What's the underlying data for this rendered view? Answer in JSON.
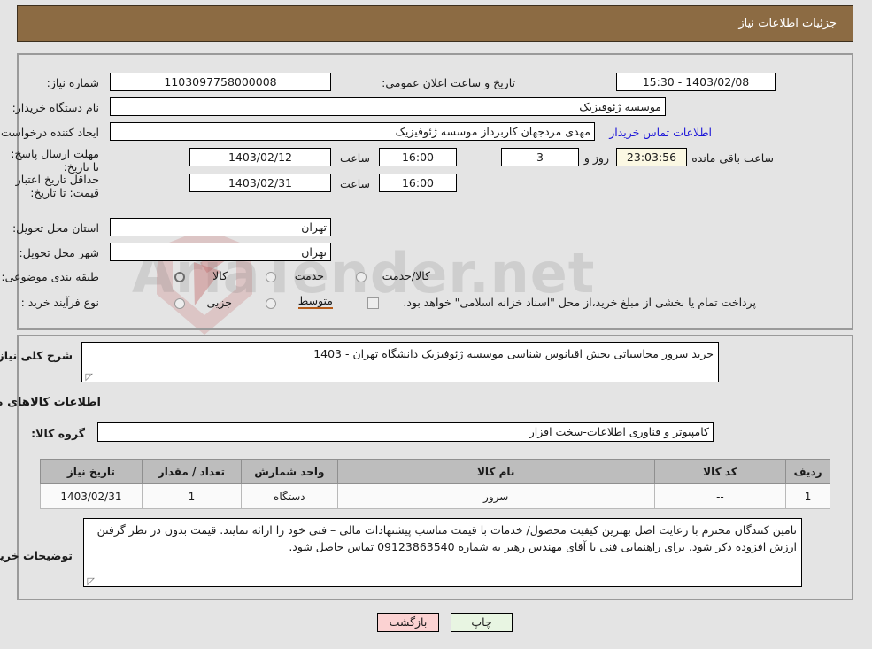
{
  "header": {
    "title": "جزئیات اطلاعات نیاز"
  },
  "watermark": {
    "text": "AriaTender.net",
    "shield_icon": "shield-icon"
  },
  "top_panel": {
    "fields": [
      {
        "label": "شماره نیاز:",
        "value": "1103097758000008"
      },
      {
        "label": "نام دستگاه خریدار:",
        "value": "موسسه ژئوفیزیک"
      },
      {
        "label": "ایجاد کننده درخواست:",
        "value": "مهدی مردجهان کاربرداز موسسه ژئوفیزیک"
      },
      {
        "label": "مهلت ارسال پاسخ: تا تاریخ:",
        "value": "1403/02/12"
      },
      {
        "label": "حداقل تاریخ اعتبار قیمت: تا تاریخ:",
        "value": "1403/02/31"
      },
      {
        "label": "استان محل تحویل:",
        "value": "تهران"
      },
      {
        "label": "شهر محل تحویل:",
        "value": "تهران"
      },
      {
        "label": "طبقه بندی موضوعی:",
        "value": "کالا"
      },
      {
        "label": "نوع فرآیند خرید :",
        "value": "متوسط"
      }
    ],
    "public_announce_label": "تاریخ و ساعت اعلان عمومی:",
    "public_announce_value": "1403/02/08 - 15:30",
    "contact_link": "اطلاعات تماس خریدار",
    "deadline_time_label": "ساعت",
    "deadline_time_value": "16:00",
    "days_value": "3",
    "days_label": "روز و",
    "countdown_value": "23:03:56",
    "countdown_label": "ساعت باقی مانده",
    "validity_time_label": "ساعت",
    "validity_time_value": "16:00",
    "classification_options": [
      "کالا",
      "خدمت",
      "کالا/خدمت"
    ],
    "classification_selected": "کالا",
    "process_options": [
      "جزیی",
      "متوسط"
    ],
    "process_selected": "متوسط",
    "treasury_checkbox_label": "پرداخت تمام یا بخشی از مبلغ خرید،از محل \"اسناد خزانه اسلامی\" خواهد بود.",
    "treasury_checkbox_checked": false
  },
  "bottom_panel": {
    "need_desc_label": "شرح کلی نیاز:",
    "need_desc_value": "خرید سرور محاسباتی بخش اقیانوس شناسی موسسه ژئوفیزیک دانشگاه تهران - 1403",
    "goods_section_title": "اطلاعات کالاهای مورد نیاز",
    "goods_group_label": "گروه کالا:",
    "goods_group_value": "کامپیوتر و فناوری اطلاعات-سخت افزار",
    "table": {
      "columns": [
        "ردیف",
        "کد کالا",
        "نام کالا",
        "واحد شمارش",
        "تعداد / مقدار",
        "تاریخ نیاز"
      ],
      "rows": [
        [
          "1",
          "--",
          "سرور",
          "دستگاه",
          "1",
          "1403/02/31"
        ]
      ]
    },
    "buyer_notes_label": "توضیحات خریدار:",
    "buyer_notes_value": "تامین کنندگان محترم با رعایت اصل بهترین کیفیت محصول/ خدمات با قیمت مناسب پیشنهادات مالی – فنی خود را ارائه نمایند. قیمت بدون در نظر گرفتن ارزش افزوده ذکر شود. برای راهنمایی فنی با آقای مهندس رهبر به شماره 09123863540 تماس حاصل شود."
  },
  "footer": {
    "back_button": "بازگشت",
    "print_button": "چاپ"
  },
  "colors": {
    "header_bg": "#8c6b43",
    "back_button_bg": "#fbd2d2",
    "print_button_bg": "#e8f5e2",
    "countdown_bg": "#fbf8e3",
    "link": "#1a14d8",
    "selected_underline": "#b55b18"
  }
}
